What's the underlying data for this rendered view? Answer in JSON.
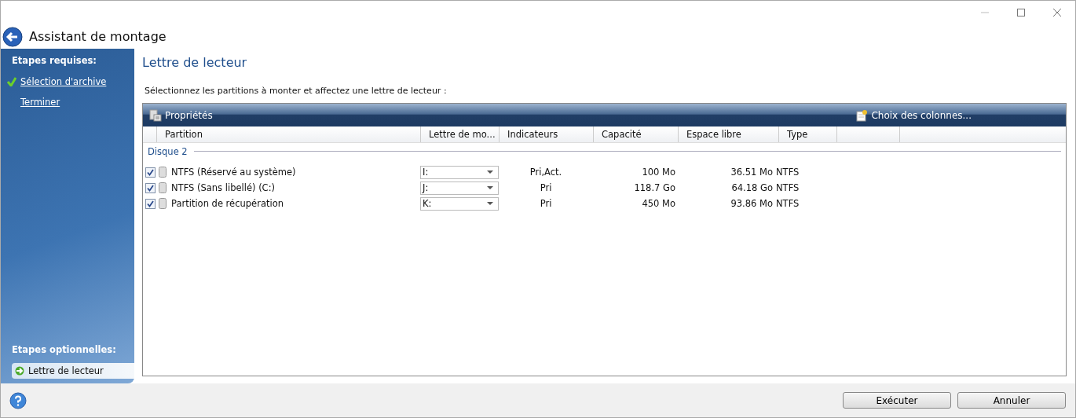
{
  "window": {
    "title": "Assistant de montage"
  },
  "sidebar": {
    "required_heading": "Etapes requises:",
    "required_steps": [
      {
        "label": "Sélection d'archive",
        "done": true,
        "selected": false
      },
      {
        "label": "Terminer",
        "done": false,
        "selected": false
      }
    ],
    "optional_heading": "Etapes optionnelles:",
    "optional_steps": [
      {
        "label": "Lettre de lecteur",
        "selected": true
      }
    ]
  },
  "page_title": "Lettre de lecteur",
  "instruction": "Sélectionnez les partitions à monter et affectez une lettre de lecteur :",
  "toolbar": {
    "properties": "Propriétés",
    "columns_choice": "Choix des colonnes..."
  },
  "table": {
    "columns": [
      "Partition",
      "Lettre de mo...",
      "Indicateurs",
      "Capacité",
      "Espace libre",
      "Type"
    ],
    "group": "Disque 2",
    "rows": [
      {
        "checked": true,
        "partition": "NTFS (Réservé au système)",
        "letter": "I:",
        "flags": "Pri,Act.",
        "capacity": "100 Mo",
        "free": "36.51 Mo",
        "type": "NTFS"
      },
      {
        "checked": true,
        "partition": "NTFS (Sans libellé) (C:)",
        "letter": "J:",
        "flags": "Pri",
        "capacity": "118.7 Go",
        "free": "64.18 Go",
        "type": "NTFS"
      },
      {
        "checked": true,
        "partition": "Partition de récupération",
        "letter": "K:",
        "flags": "Pri",
        "capacity": "450 Mo",
        "free": "93.86 Mo",
        "type": "NTFS"
      }
    ]
  },
  "buttons": [
    "Exécuter",
    "Annuler"
  ]
}
